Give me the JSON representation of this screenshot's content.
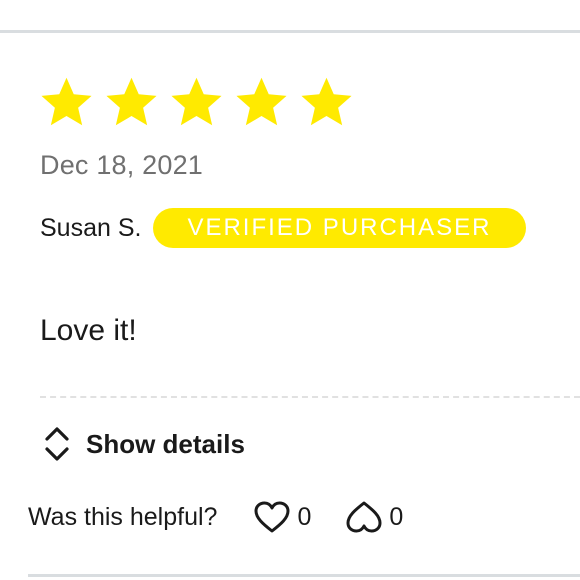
{
  "review": {
    "rating": 5,
    "rating_max": 5,
    "star_color": "#ffea00",
    "date": "Dec 18, 2021",
    "author": "Susan S.",
    "badge": "VERIFIED PURCHASER",
    "badge_color": "#ffea00",
    "text": "Love it!"
  },
  "details": {
    "label": "Show details",
    "icon": "chevron-up-down-icon"
  },
  "helpful": {
    "question": "Was this helpful?",
    "like": {
      "icon": "heart-icon",
      "count": "0"
    },
    "dislike": {
      "icon": "dislike-icon",
      "count": "0"
    }
  }
}
